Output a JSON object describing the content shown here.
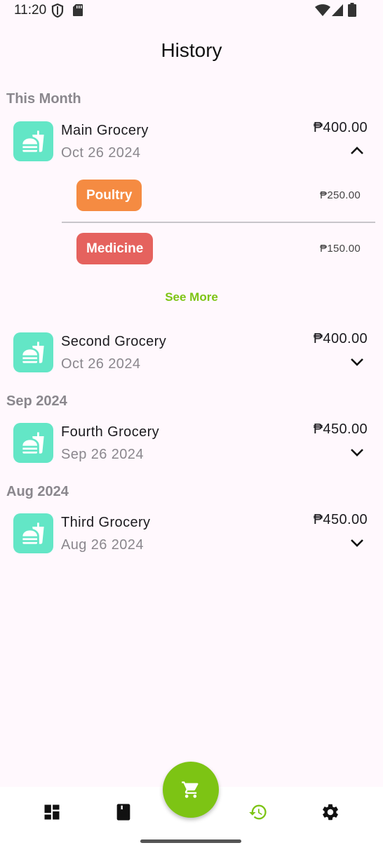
{
  "status_bar": {
    "time": "11:20"
  },
  "header": {
    "title": "History"
  },
  "sections": [
    {
      "title": "This Month"
    },
    {
      "title": "Sep 2024"
    },
    {
      "title": "Aug 2024"
    }
  ],
  "entries": [
    {
      "name": "Main Grocery",
      "date": "Oct 26 2024",
      "amount": "₱400.00",
      "expanded": true,
      "icon": "food-icon"
    },
    {
      "name": "Second Grocery",
      "date": "Oct 26 2024",
      "amount": "₱400.00",
      "expanded": false,
      "icon": "food-icon"
    },
    {
      "name": "Fourth Grocery",
      "date": "Sep 26 2024",
      "amount": "₱450.00",
      "expanded": false,
      "icon": "food-icon"
    },
    {
      "name": "Third Grocery",
      "date": "Aug 26 2024",
      "amount": "₱450.00",
      "expanded": false,
      "icon": "food-icon"
    }
  ],
  "expanded_items": [
    {
      "category": "Poultry",
      "price": "₱250.00",
      "color": "#f58b42"
    },
    {
      "category": "Medicine",
      "price": "₱150.00",
      "color": "#e5625e"
    }
  ],
  "see_more_label": "See More",
  "nav": {
    "items": [
      "dashboard-icon",
      "book-icon",
      "cart-icon",
      "history-icon",
      "settings-icon"
    ],
    "active": "history-icon"
  },
  "colors": {
    "accent": "#7dc414",
    "icon_bg": "#63e6c6",
    "background": "#fff8fd"
  }
}
